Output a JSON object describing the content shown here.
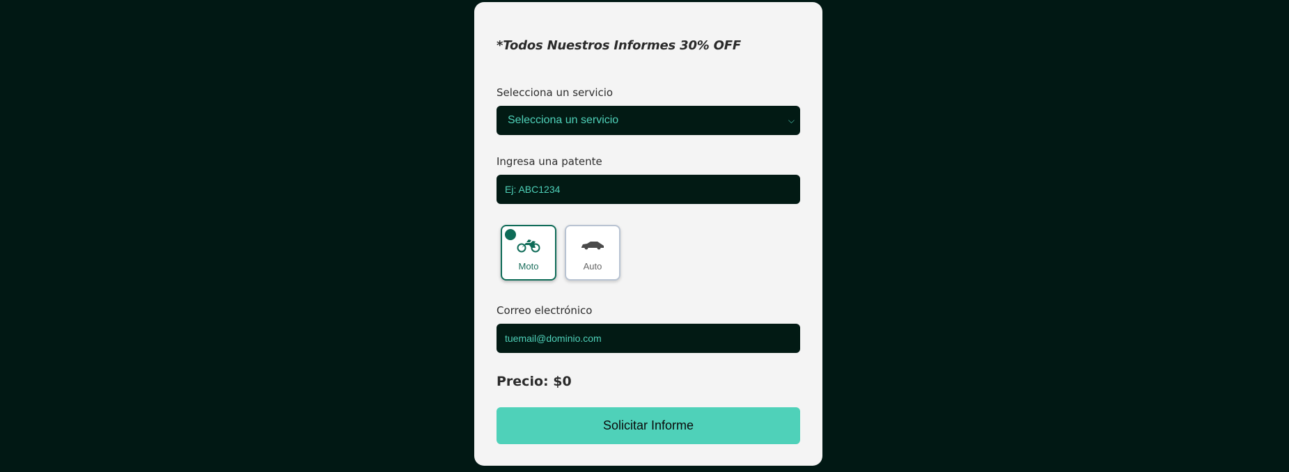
{
  "form": {
    "promo": "*Todos Nuestros Informes 30% OFF",
    "service_label": "Selecciona un servicio",
    "service_selected": "Selecciona un servicio",
    "plate_label": "Ingresa una patente",
    "plate_placeholder": "Ej: ABC1234",
    "vehicles": [
      {
        "label": "Moto",
        "icon": "motorcycle-icon",
        "selected": true
      },
      {
        "label": "Auto",
        "icon": "car-icon",
        "selected": false
      }
    ],
    "email_label": "Correo electrónico",
    "email_placeholder": "tuemail@dominio.com",
    "price": "Precio: $0",
    "submit_label": "Solicitar Informe"
  },
  "colors": {
    "page_background": "#011814",
    "card_background": "#f4f4f4",
    "field_background": "#021a14",
    "accent": "#4fd1b9",
    "selected_border": "#0e6b57"
  }
}
